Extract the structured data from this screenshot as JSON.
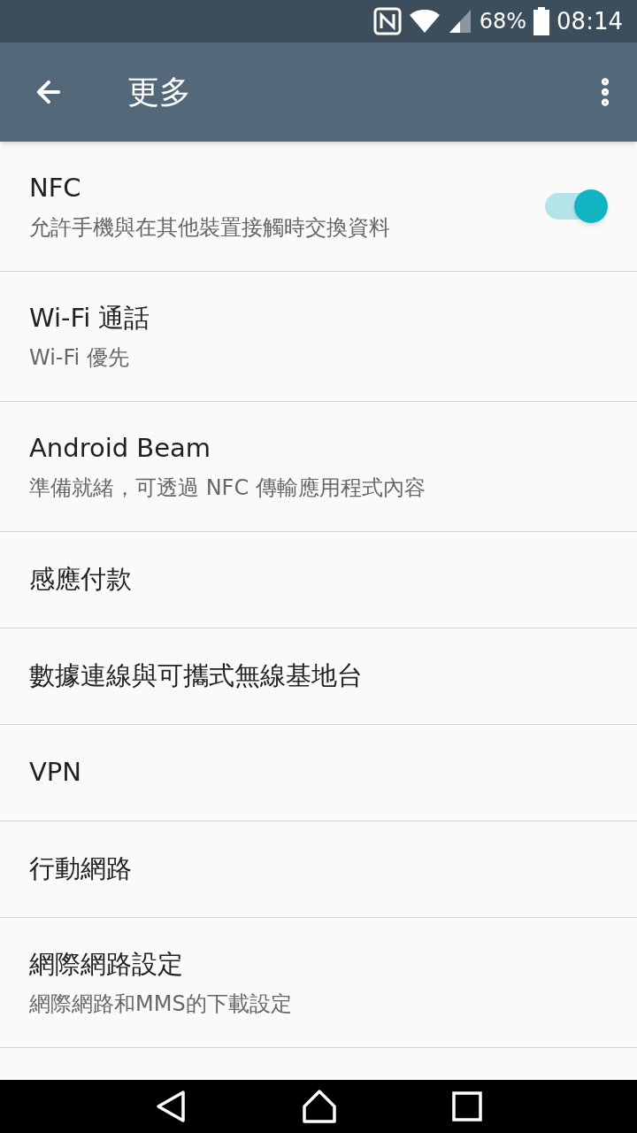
{
  "status_bar": {
    "battery": "68%",
    "time": "08:14"
  },
  "app_bar": {
    "title": "更多"
  },
  "items": [
    {
      "kind": "switch",
      "title": "NFC",
      "subtitle": "允許手機與在其他裝置接觸時交換資料",
      "on": true
    },
    {
      "kind": "plain",
      "title": "Wi-Fi 通話",
      "subtitle": "Wi-Fi 優先"
    },
    {
      "kind": "plain",
      "title": "Android Beam",
      "subtitle": "準備就緒，可透過 NFC 傳輸應用程式內容"
    },
    {
      "kind": "plain",
      "title": "感應付款"
    },
    {
      "kind": "plain",
      "title": "數據連線與可攜式無線基地台"
    },
    {
      "kind": "plain",
      "title": "VPN"
    },
    {
      "kind": "plain",
      "title": "行動網路"
    },
    {
      "kind": "plain",
      "title": "網際網路設定",
      "subtitle": "網際網路和MMS的下載設定"
    }
  ]
}
